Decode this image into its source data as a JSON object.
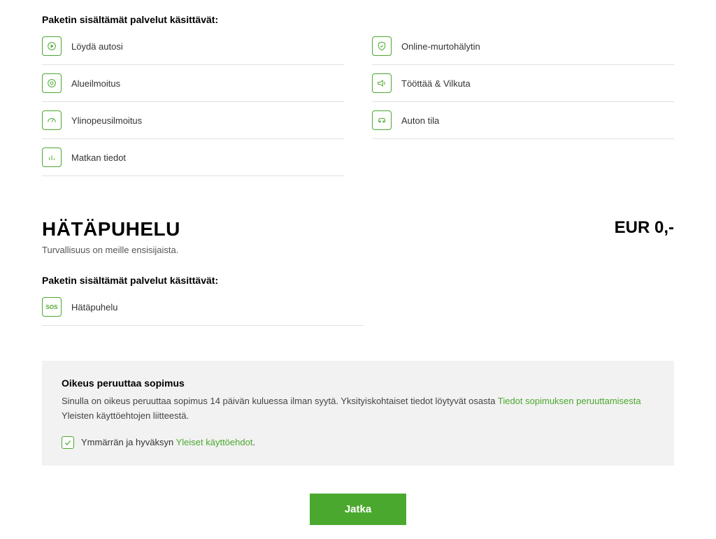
{
  "section1": {
    "heading": "Paketin sisältämät palvelut käsittävät:",
    "services_left": [
      {
        "label": "Löydä autosi"
      },
      {
        "label": "Alueilmoitus"
      },
      {
        "label": "Ylinopeusilmoitus"
      },
      {
        "label": "Matkan tiedot"
      }
    ],
    "services_right": [
      {
        "label": "Online-murtohälytin"
      },
      {
        "label": "Tööttää & Vilkuta"
      },
      {
        "label": "Auton tila"
      }
    ]
  },
  "plan": {
    "title": "HÄTÄPUHELU",
    "price": "EUR 0,-",
    "subtitle": "Turvallisuus on meille ensisijaista.",
    "services_heading": "Paketin sisältämät palvelut käsittävät:",
    "services": [
      {
        "label": "Hätäpuhelu"
      }
    ]
  },
  "terms": {
    "title": "Oikeus peruuttaa sopimus",
    "text_before": "Sinulla on oikeus peruuttaa sopimus 14 päivän kuluessa ilman syytä. Yksityiskohtaiset tiedot löytyvät osasta ",
    "link_text": "Tiedot sopimuksen peruuttamisesta",
    "text_after": " Yleisten käyttöehtojen liitteestä.",
    "checkbox_label_before": "Ymmärrän ja hyväksyn ",
    "checkbox_link": "Yleiset käyttöehdot"
  },
  "button": {
    "continue": "Jatka"
  }
}
